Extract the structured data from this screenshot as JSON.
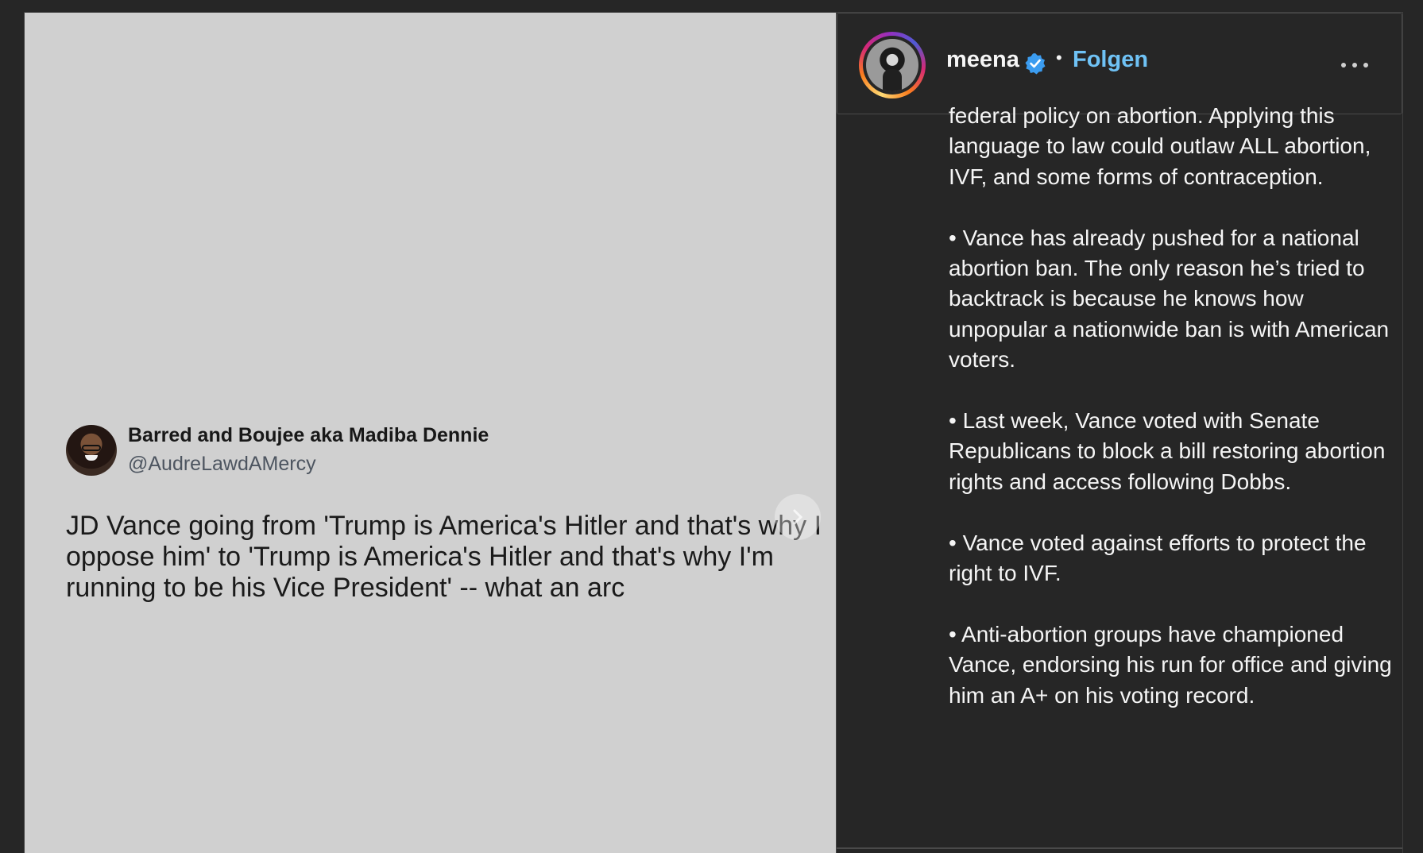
{
  "tweet": {
    "name": "Barred and Boujee aka Madiba Dennie",
    "handle": "@AudreLawdAMercy",
    "text": "JD Vance going from 'Trump is America's Hitler and that's why I oppose him' to 'Trump is America's Hitler and that's why I'm running to be his Vice President' -- what an arc"
  },
  "post": {
    "username": "meena",
    "separator": "•",
    "follow_label": "Folgen",
    "verified": true,
    "caption": "federal policy on abortion. Applying this language to law could outlaw ALL abortion, IVF, and some forms of contraception.\n\n• Vance has already pushed for a national abortion ban. The only reason he’s tried to backtrack is because he knows how unpopular a nationwide ban is with American voters.\n\n• Last week, Vance voted with Senate Republicans to block a bill restoring abortion rights and access following Dobbs.\n\n• Vance voted against efforts to protect the right to IVF.\n\n• Anti-abortion groups have championed Vance, endorsing his run for office and giving him an A+ on his voting record."
  },
  "icons": {
    "verified": "verified-badge-icon",
    "more": "more-options-icon",
    "next": "chevron-right-icon"
  },
  "colors": {
    "background": "#262626",
    "media_background": "#d0d0d0",
    "follow": "#6fc2f5",
    "verified": "#3b9cf0",
    "text": "#f5f5f5"
  }
}
